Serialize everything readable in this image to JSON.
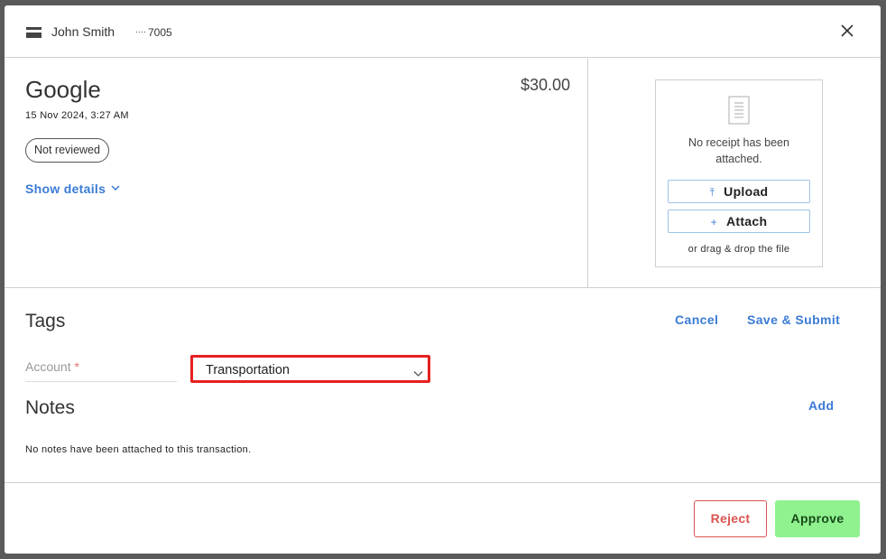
{
  "header": {
    "cardholder": "John Smith",
    "card_mask": "····",
    "card_last4": "7005"
  },
  "transaction": {
    "merchant": "Google",
    "amount": "$30.00",
    "date": "15 Nov 2024, 3:27 AM",
    "status": "Not reviewed",
    "show_details_label": "Show details"
  },
  "receipt": {
    "empty_message": "No receipt has been attached.",
    "upload_label": "Upload",
    "attach_label": "Attach",
    "drag_hint": "or drag & drop the file"
  },
  "tags": {
    "title": "Tags",
    "cancel_label": "Cancel",
    "save_label": "Save & Submit",
    "account_label": "Account",
    "account_required_marker": "*",
    "account_value": "Transportation"
  },
  "notes": {
    "title": "Notes",
    "add_label": "Add",
    "empty_message": "No notes have been attached to this transaction."
  },
  "footer": {
    "reject_label": "Reject",
    "approve_label": "Approve"
  },
  "colors": {
    "accent": "#3a7bd5",
    "reject": "#d9534f",
    "approve_bg": "#8ff28f",
    "highlight": "#e62020"
  }
}
